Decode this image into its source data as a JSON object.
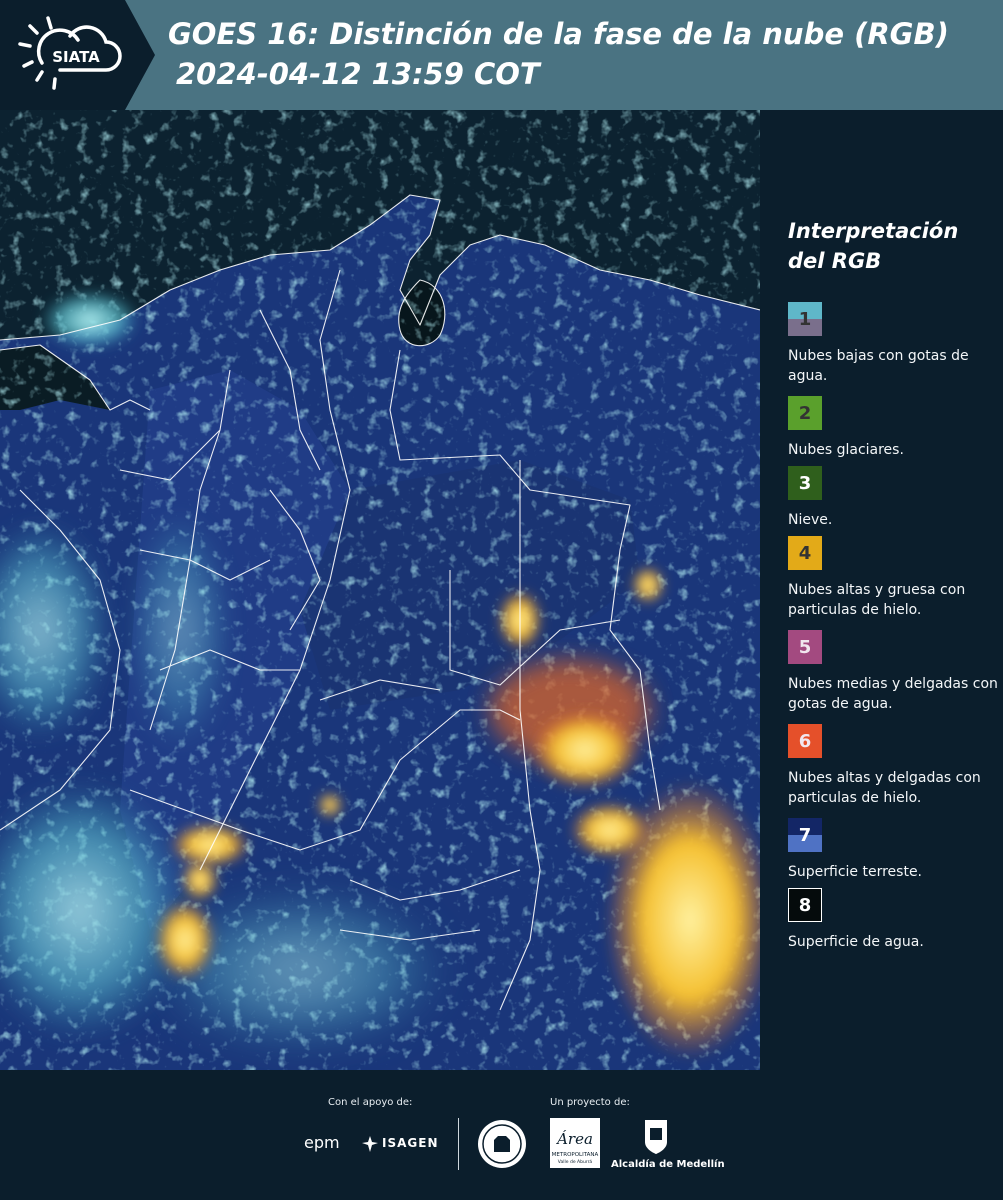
{
  "header": {
    "logo_text": "SIATA",
    "title_line1": "GOES 16: Distinción de la fase de la nube (RGB)",
    "title_line2": "2024-04-12 13:59 COT"
  },
  "legend": {
    "title_line1": "Interpretación",
    "title_line2": "del RGB",
    "items": [
      {
        "num": "1",
        "label": "Nubes bajas con gotas de agua.",
        "top_color": "#5fb7c9",
        "bottom_color": "#7a6f8c"
      },
      {
        "num": "2",
        "label": "Nubes glaciares.",
        "top_color": "#5aa02c",
        "bottom_color": "#5aa02c"
      },
      {
        "num": "3",
        "label": "Nieve.",
        "top_color": "#2f5f1c",
        "bottom_color": "#2f5f1c"
      },
      {
        "num": "4",
        "label": "Nubes altas y gruesa con particulas de hielo.",
        "top_color": "#e3aa18",
        "bottom_color": "#e3aa18"
      },
      {
        "num": "5",
        "label": "Nubes medias y delgadas con gotas de agua.",
        "top_color": "#a34a80",
        "bottom_color": "#a34a80"
      },
      {
        "num": "6",
        "label": "Nubes altas y delgadas con particulas de hielo.",
        "top_color": "#e5502a",
        "bottom_color": "#e5502a"
      },
      {
        "num": "7",
        "label": "Superficie terreste.",
        "top_color": "#132666",
        "bottom_color": "#4f72c4"
      },
      {
        "num": "8",
        "label": "Superficie de agua.",
        "top_color": "#050b0c",
        "bottom_color": "#050b0c"
      }
    ]
  },
  "footer": {
    "support_caption": "Con el apoyo de:",
    "project_caption": "Un proyecto de:",
    "sponsor_epm": "epm",
    "sponsor_isagen": "ISAGEN",
    "area_line1": "Área",
    "area_line2": "METROPOLITANA",
    "area_line3": "Valle de Aburrá",
    "alcaldia": "Alcaldía de Medellín"
  },
  "colors": {
    "header_bg": "#4a7382",
    "logo_bg": "#0b1e2c",
    "page_bg": "#0b1e2c",
    "ocean": "#091b24",
    "land": "#1c3a7a",
    "cloud_cyan": "#6fd6e0",
    "cloud_yellow": "#f5c94a",
    "cloud_orange": "#e86a2a",
    "border_white": "#ffffff"
  }
}
